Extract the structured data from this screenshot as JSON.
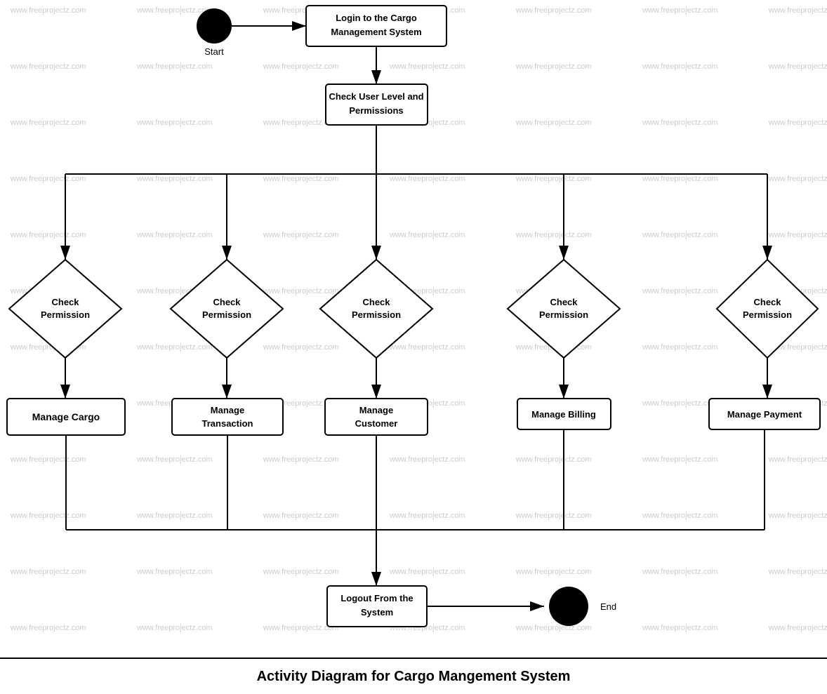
{
  "diagram": {
    "title": "Activity Diagram for Cargo Mangement System",
    "watermark_text": "www.freeprojectz.com",
    "nodes": {
      "start_label": "Start",
      "end_label": "End",
      "login": "Login to the Cargo Management System",
      "check_user_level": "Check User Level and Permissions",
      "check_permission_1": "Check Permission",
      "check_permission_2": "Check Permission",
      "check_permission_3": "Check Permission",
      "check_permission_4": "Check Permission",
      "check_permission_5": "Check Permission",
      "manage_cargo": "Manage Cargo",
      "manage_transaction": "Manage Transaction",
      "manage_customer": "Manage Customer",
      "manage_billing": "Manage Billing",
      "manage_payment": "Manage Payment",
      "logout": "Logout From the System"
    }
  }
}
